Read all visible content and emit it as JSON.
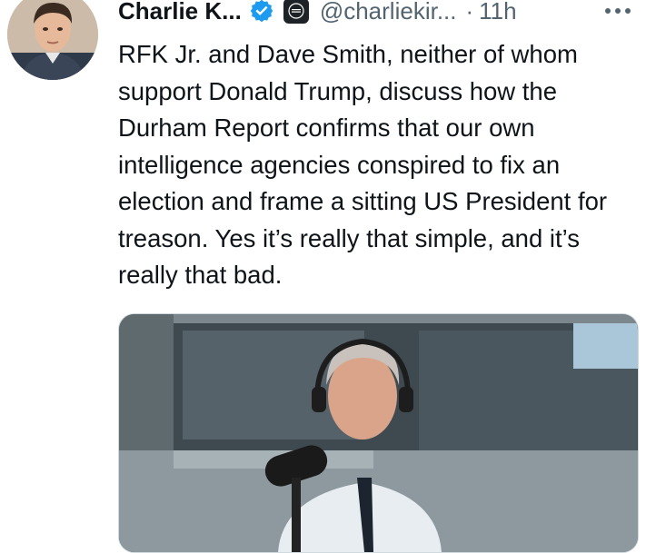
{
  "tweet": {
    "author_name": "Charlie K...",
    "handle": "@charliekir...",
    "separator": "·",
    "timestamp": "11h",
    "body": "RFK Jr. and Dave Smith, neither of whom support Donald Trump, discuss how the Durham Report confirms that our own intelligence agencies conspired to fix an election and frame a sitting US President for treason. Yes it’s really that simple, and it’s really that bad."
  },
  "icons": {
    "verified": "verified-badge-icon",
    "org": "organization-badge-icon",
    "more": "more-options-icon"
  },
  "colors": {
    "verified_blue": "#1d9bf0",
    "secondary_text": "#536471",
    "primary_text": "#0f1419"
  }
}
